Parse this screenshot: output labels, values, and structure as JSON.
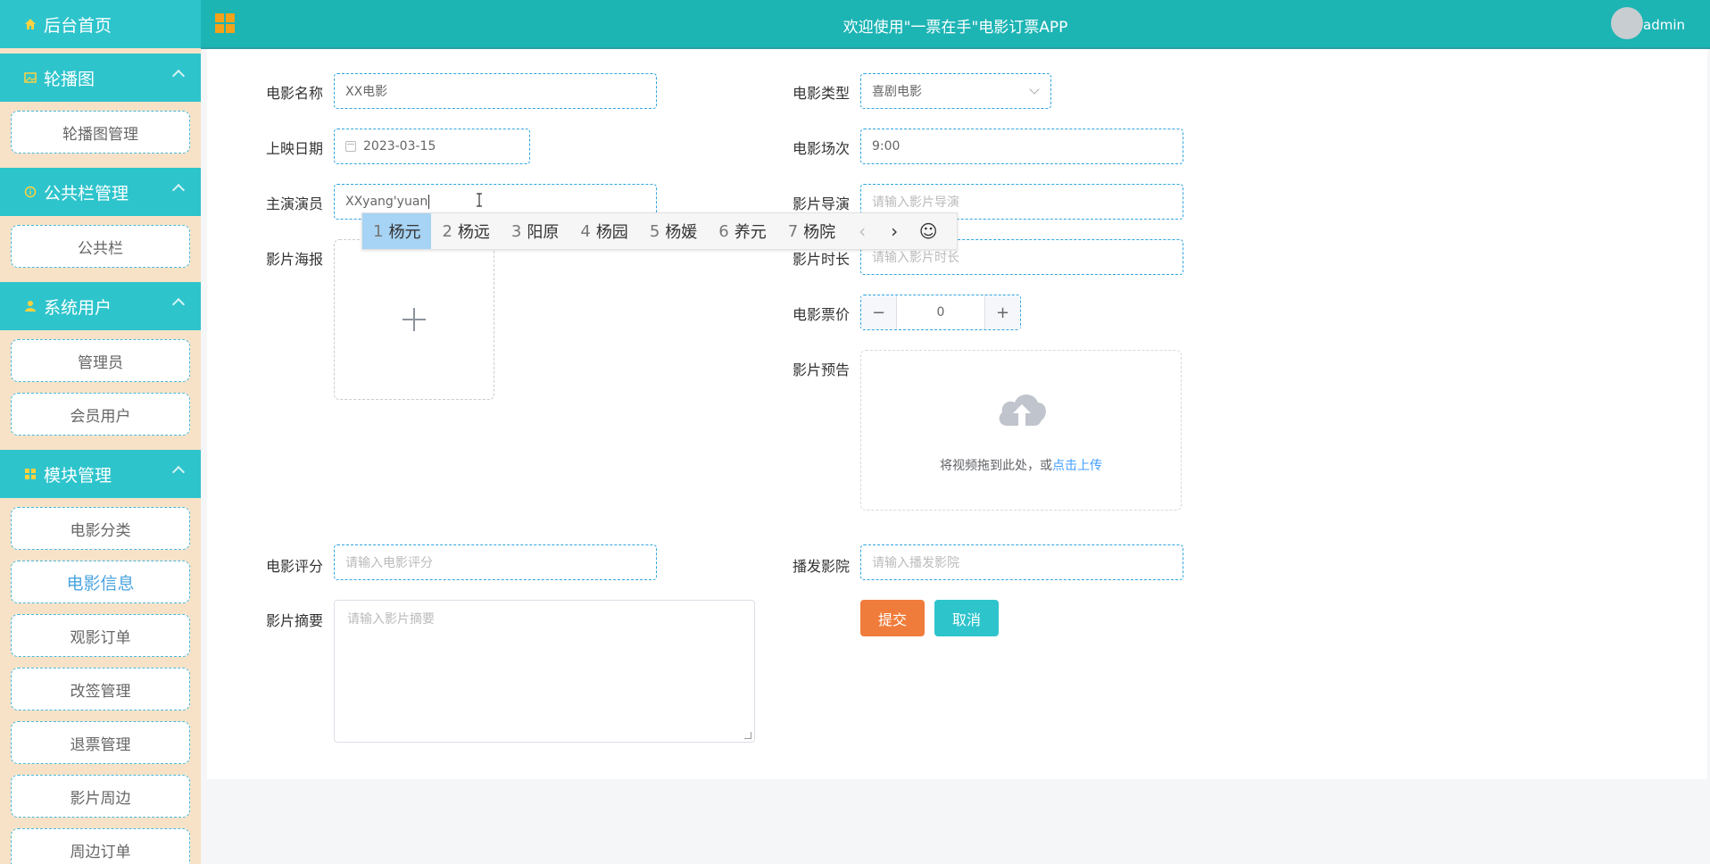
{
  "sidebar": {
    "home": "后台首页",
    "groups": [
      {
        "title": "轮播图",
        "items": [
          "轮播图管理"
        ]
      },
      {
        "title": "公共栏管理",
        "items": [
          "公共栏"
        ]
      },
      {
        "title": "系统用户",
        "items": [
          "管理员",
          "会员用户"
        ]
      },
      {
        "title": "模块管理",
        "items": [
          "电影分类",
          "电影信息",
          "观影订单",
          "改签管理",
          "退票管理",
          "影片周边",
          "周边订单"
        ]
      }
    ],
    "active_item": "电影信息"
  },
  "topbar": {
    "title": "欢迎使用\"一票在手\"电影订票APP",
    "username": "admin"
  },
  "form": {
    "movie_name": {
      "label": "电影名称",
      "value": "XX电影"
    },
    "movie_type": {
      "label": "电影类型",
      "value": "喜剧电影"
    },
    "release_date": {
      "label": "上映日期",
      "value": "2023-03-15"
    },
    "showtime": {
      "label": "电影场次",
      "value": "9:00"
    },
    "lead_actor": {
      "label": "主演演员",
      "value": "XXyang'yuan"
    },
    "director": {
      "label": "影片导演",
      "placeholder": "请输入影片导演"
    },
    "poster": {
      "label": "影片海报"
    },
    "duration": {
      "label": "影片时长",
      "placeholder": "请输入影片时长"
    },
    "price": {
      "label": "电影票价",
      "value": "0",
      "minus": "−",
      "plus": "+"
    },
    "trailer": {
      "label": "影片预告",
      "hint": "将视频拖到此处，或",
      "link": "点击上传"
    },
    "rating": {
      "label": "电影评分",
      "placeholder": "请输入电影评分"
    },
    "cinema": {
      "label": "播发影院",
      "placeholder": "请输入播发影院"
    },
    "summary": {
      "label": "影片摘要",
      "placeholder": "请输入影片摘要"
    },
    "submit": "提交",
    "cancel": "取消"
  },
  "ime": {
    "candidates": [
      {
        "n": "1",
        "text": "杨元"
      },
      {
        "n": "2",
        "text": "杨远"
      },
      {
        "n": "3",
        "text": "阳原"
      },
      {
        "n": "4",
        "text": "杨园"
      },
      {
        "n": "5",
        "text": "杨媛"
      },
      {
        "n": "6",
        "text": "养元"
      },
      {
        "n": "7",
        "text": "杨院"
      }
    ],
    "prev": "‹",
    "next": "›",
    "emoji": "☺"
  }
}
